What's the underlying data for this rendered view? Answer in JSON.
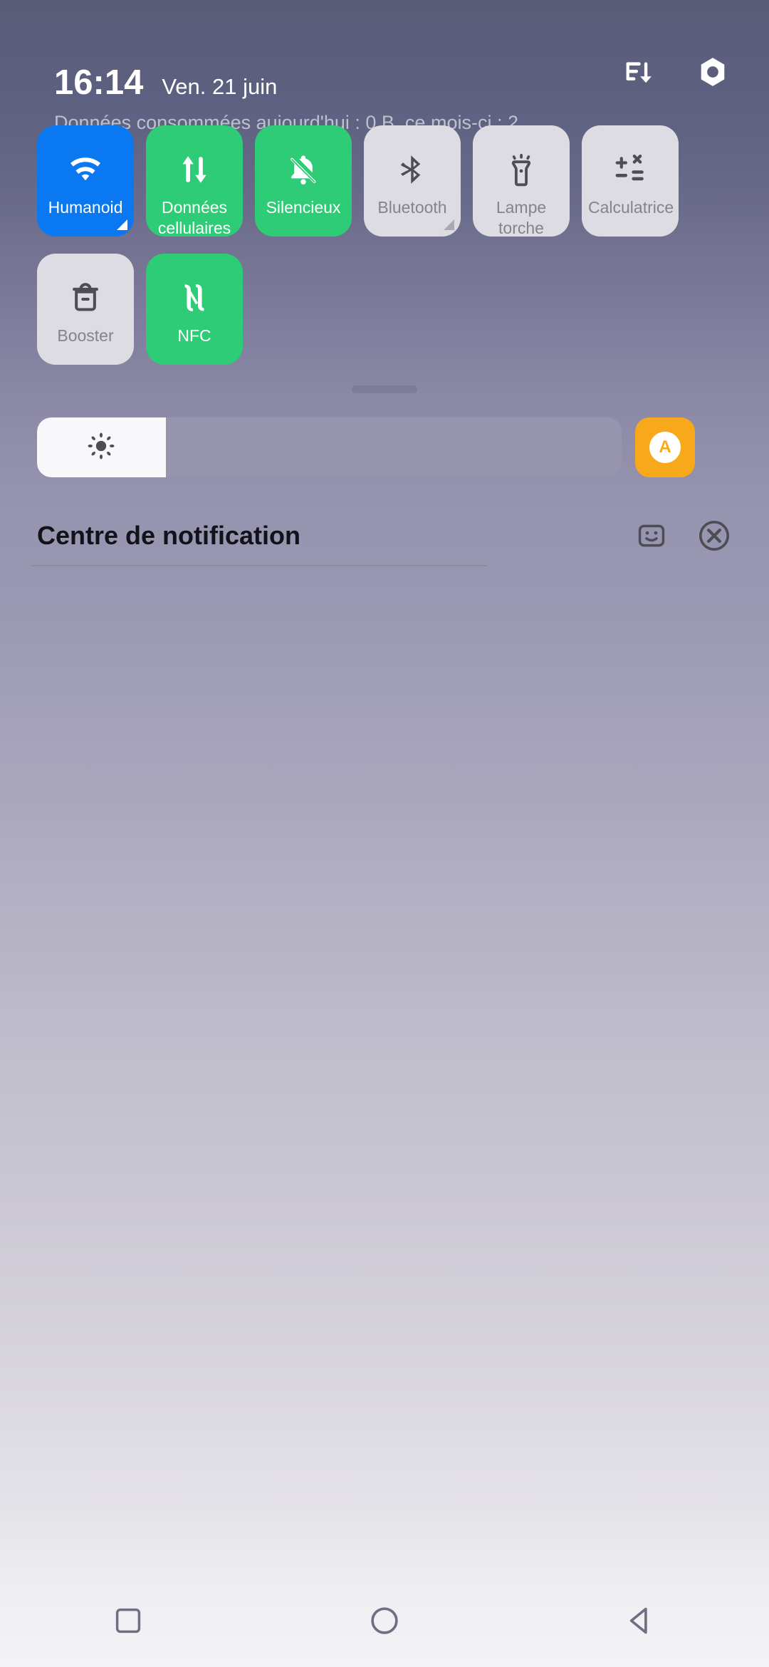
{
  "statusbar": {
    "time": "16:14",
    "date": "Ven. 21 juin",
    "data_usage": "Données consommées aujourd'hui : 0 B, ce mois-ci : 2…",
    "icons": {
      "sort": "sort-descending-icon",
      "settings": "hex-nut-settings-icon"
    }
  },
  "tiles": [
    {
      "label": "Humanoid",
      "state": "on-blue",
      "icon": "wifi-icon",
      "corner": true
    },
    {
      "label": "Données cellulaires",
      "state": "on-green",
      "icon": "mobile-data-icon",
      "corner": false
    },
    {
      "label": "Silencieux",
      "state": "on-green",
      "icon": "bell-off-icon",
      "corner": false
    },
    {
      "label": "Bluetooth",
      "state": "off",
      "icon": "bluetooth-icon",
      "corner": true
    },
    {
      "label": "Lampe torche",
      "state": "off",
      "icon": "flashlight-icon",
      "corner": false
    },
    {
      "label": "Calculatrice",
      "state": "off",
      "icon": "calculator-icon",
      "corner": false
    },
    {
      "label": "Booster",
      "state": "off",
      "icon": "trash-boost-icon",
      "corner": false
    },
    {
      "label": "NFC",
      "state": "on-green",
      "icon": "nfc-icon",
      "corner": false
    }
  ],
  "brightness": {
    "icon": "brightness-sun-icon",
    "value_percent": 22,
    "auto_label": "A",
    "auto_color": "#f7a81b"
  },
  "notification_center": {
    "title": "Centre de notification",
    "settings_icon": "notification-settings-icon",
    "clear_icon": "clear-all-icon"
  },
  "navbar": {
    "recents": "square-recents-icon",
    "home": "circle-home-icon",
    "back": "triangle-back-icon"
  },
  "colors": {
    "accent_blue": "#0a78f0",
    "accent_green": "#2ecc76",
    "tile_off": "#dddce3",
    "auto_orange": "#f7a81b"
  }
}
